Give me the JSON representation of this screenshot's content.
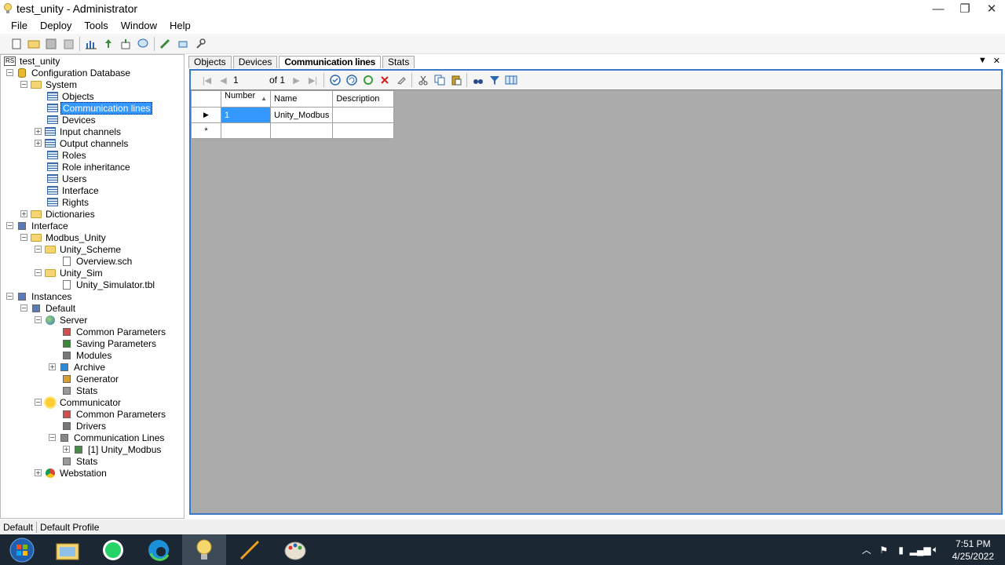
{
  "window": {
    "title": "test_unity - Administrator",
    "min_icon": "minimize-icon",
    "max_icon": "maximize-icon",
    "close_icon": "close-icon"
  },
  "menu": [
    "File",
    "Deploy",
    "Tools",
    "Window",
    "Help"
  ],
  "toolbar_icons": [
    "new-file-icon",
    "open-folder-icon",
    "save-icon",
    "save-all-icon",
    "chart-icon",
    "upload-icon",
    "download-icon",
    "help-icon",
    "deploy-icon",
    "import-icon",
    "tools-icon"
  ],
  "tree": [
    {
      "label": "test_unity",
      "icon": "rs"
    },
    {
      "label": "Configuration Database",
      "icon": "db"
    },
    {
      "label": "System",
      "icon": "folder"
    },
    {
      "label": "Objects",
      "icon": "grid"
    },
    {
      "label": "Communication lines",
      "icon": "grid"
    },
    {
      "label": "Devices",
      "icon": "grid"
    },
    {
      "label": "Input channels",
      "icon": "grid"
    },
    {
      "label": "Output channels",
      "icon": "grid"
    },
    {
      "label": "Roles",
      "icon": "grid"
    },
    {
      "label": "Role inheritance",
      "icon": "grid"
    },
    {
      "label": "Users",
      "icon": "grid"
    },
    {
      "label": "Interface",
      "icon": "grid"
    },
    {
      "label": "Rights",
      "icon": "grid"
    },
    {
      "label": "Dictionaries",
      "icon": "folder"
    },
    {
      "label": "Interface",
      "icon": "interface"
    },
    {
      "label": "Modbus_Unity",
      "icon": "folder"
    },
    {
      "label": "Unity_Scheme",
      "icon": "folder"
    },
    {
      "label": "Overview.sch",
      "icon": "doc"
    },
    {
      "label": "Unity_Sim",
      "icon": "folder"
    },
    {
      "label": "Unity_Simulator.tbl",
      "icon": "doc"
    },
    {
      "label": "Instances",
      "icon": "instances"
    },
    {
      "label": "Default",
      "icon": "instance"
    },
    {
      "label": "Server",
      "icon": "globe"
    },
    {
      "label": "Common Parameters",
      "icon": "params"
    },
    {
      "label": "Saving Parameters",
      "icon": "save"
    },
    {
      "label": "Modules",
      "icon": "modules"
    },
    {
      "label": "Archive",
      "icon": "archive"
    },
    {
      "label": "Generator",
      "icon": "generator"
    },
    {
      "label": "Stats",
      "icon": "stats"
    },
    {
      "label": "Communicator",
      "icon": "sun"
    },
    {
      "label": "Common Parameters",
      "icon": "params"
    },
    {
      "label": "Drivers",
      "icon": "modules"
    },
    {
      "label": "Communication Lines",
      "icon": "lines"
    },
    {
      "label": "[1] Unity_Modbus",
      "icon": "line"
    },
    {
      "label": "Stats",
      "icon": "stats"
    },
    {
      "label": "Webstation",
      "icon": "chrome"
    }
  ],
  "tabs": [
    "Objects",
    "Devices",
    "Communication lines",
    "Stats"
  ],
  "tab_tools": {
    "dropdown": "▼",
    "close": "✕"
  },
  "navigator": {
    "position": "1",
    "of_label": "of 1"
  },
  "grid": {
    "columns": [
      "Number",
      "Name",
      "Description"
    ],
    "rows": [
      {
        "number": "1",
        "name": "Unity_Modbus",
        "description": ""
      }
    ],
    "new_row_marker": "*"
  },
  "statusbar": {
    "instance": "Default",
    "profile": "Default Profile"
  },
  "taskbar": {
    "apps": [
      "start-icon",
      "file-explorer-icon",
      "whatsapp-icon",
      "edge-icon",
      "scada-admin-icon",
      "pen-icon",
      "paint-icon"
    ],
    "time": "7:51 PM",
    "date": "4/25/2022"
  },
  "colors": {
    "selection": "#3399ff",
    "grid_bg": "#ababab",
    "taskbar": "#1b2733",
    "frame": "#3c78c8"
  }
}
